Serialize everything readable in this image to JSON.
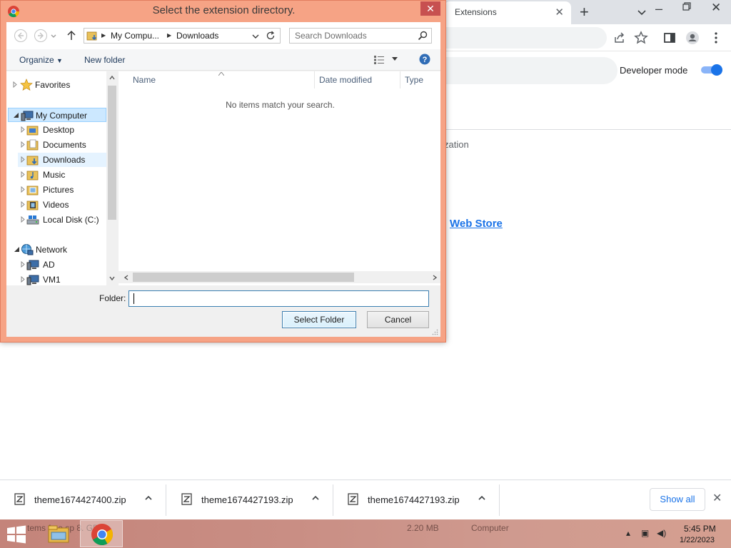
{
  "browser": {
    "tab_title": "Extensions",
    "developer_mode_label": "Developer mode",
    "developer_mode_on": true,
    "fragment_text": "zation",
    "fragment_link": "Web Store",
    "accent_color": "#1a73e8"
  },
  "downloads": {
    "items": [
      {
        "name": "theme1674427400.zip"
      },
      {
        "name": "theme1674427193.zip"
      },
      {
        "name": "theme1674427193.zip"
      }
    ],
    "show_all_label": "Show all"
  },
  "dialog": {
    "title": "Select the extension directory.",
    "breadcrumb": [
      "My Compu...",
      "Downloads"
    ],
    "search_placeholder": "Search Downloads",
    "organize_label": "Organize",
    "new_folder_label": "New folder",
    "tree": [
      {
        "label": "Favorites",
        "icon": "star-icon"
      },
      {
        "label": "My Computer",
        "icon": "computer-icon"
      },
      {
        "label": "Desktop",
        "icon": "desktop-folder-icon"
      },
      {
        "label": "Documents",
        "icon": "documents-folder-icon"
      },
      {
        "label": "Downloads",
        "icon": "downloads-folder-icon"
      },
      {
        "label": "Music",
        "icon": "music-folder-icon"
      },
      {
        "label": "Pictures",
        "icon": "pictures-folder-icon"
      },
      {
        "label": "Videos",
        "icon": "videos-folder-icon"
      },
      {
        "label": "Local Disk (C:)",
        "icon": "drive-icon"
      },
      {
        "label": "Network",
        "icon": "network-icon"
      },
      {
        "label": "AD",
        "icon": "computer-icon"
      },
      {
        "label": "VM1",
        "icon": "computer-icon"
      }
    ],
    "columns": [
      "Name",
      "Date modified",
      "Type"
    ],
    "empty_message": "No items match your search.",
    "folder_label": "Folder:",
    "folder_value": "",
    "select_button": "Select Folder",
    "cancel_button": "Cancel"
  },
  "taskbar": {
    "ghost_items_text": "tems  free sp  8.  GB)",
    "ghost_size": "2.20 MB",
    "ghost_location": "Computer",
    "time": "5:45 PM",
    "date": "1/22/2023"
  }
}
